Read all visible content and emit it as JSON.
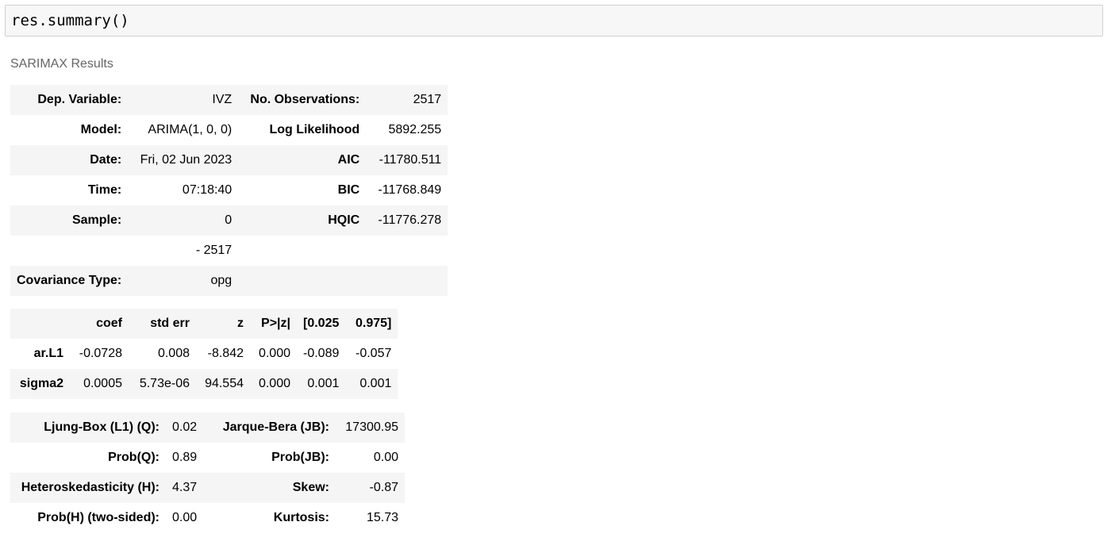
{
  "code_cell": {
    "code": "res.summary()"
  },
  "output": {
    "caption": "SARIMAX Results",
    "info_table": {
      "rows": [
        [
          "Dep. Variable:",
          "IVZ",
          "No. Observations:",
          "2517"
        ],
        [
          "Model:",
          "ARIMA(1, 0, 0)",
          "Log Likelihood",
          "5892.255"
        ],
        [
          "Date:",
          "Fri, 02 Jun 2023",
          "AIC",
          "-11780.511"
        ],
        [
          "Time:",
          "07:18:40",
          "BIC",
          "-11768.849"
        ],
        [
          "Sample:",
          "0",
          "HQIC",
          "-11776.278"
        ],
        [
          "",
          "- 2517",
          "",
          ""
        ],
        [
          "Covariance Type:",
          "opg",
          "",
          ""
        ]
      ]
    },
    "coef_table": {
      "header": [
        "",
        "coef",
        "std err",
        "z",
        "P>|z|",
        "[0.025",
        "0.975]"
      ],
      "rows": [
        [
          "ar.L1",
          "-0.0728",
          "0.008",
          "-8.842",
          "0.000",
          "-0.089",
          "-0.057"
        ],
        [
          "sigma2",
          "0.0005",
          "5.73e-06",
          "94.554",
          "0.000",
          "0.001",
          "0.001"
        ]
      ]
    },
    "diag_table": {
      "rows": [
        [
          "Ljung-Box (L1) (Q):",
          "0.02",
          "Jarque-Bera (JB):",
          "17300.95"
        ],
        [
          "Prob(Q):",
          "0.89",
          "Prob(JB):",
          "0.00"
        ],
        [
          "Heteroskedasticity (H):",
          "4.37",
          "Skew:",
          "-0.87"
        ],
        [
          "Prob(H) (two-sided):",
          "0.00",
          "Kurtosis:",
          "15.73"
        ]
      ]
    }
  }
}
